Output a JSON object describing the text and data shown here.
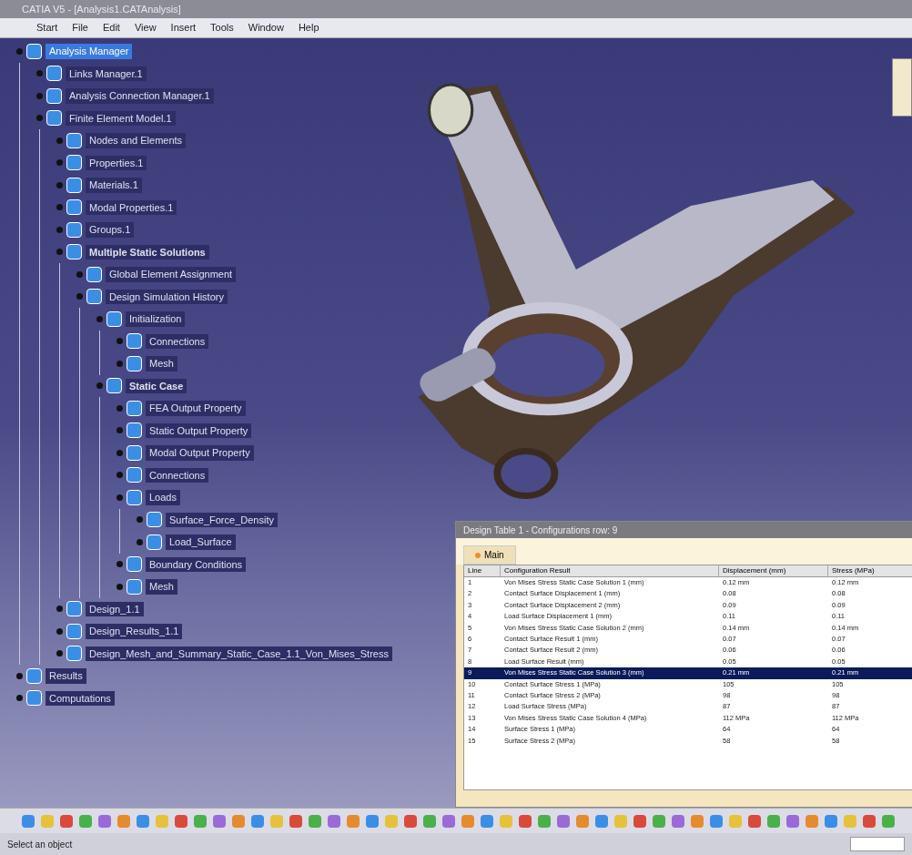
{
  "window": {
    "title": "CATIA V5 - [Analysis1.CATAnalysis]"
  },
  "menu": [
    "Start",
    "File",
    "Edit",
    "View",
    "Insert",
    "Tools",
    "Window",
    "Help"
  ],
  "tree": [
    {
      "label": "Analysis Manager",
      "selected": true,
      "bold": false,
      "children": [
        {
          "label": "Links Manager.1",
          "selected": false,
          "bold": false
        },
        {
          "label": "Analysis Connection Manager.1",
          "selected": false,
          "bold": false
        },
        {
          "label": "Finite Element Model.1",
          "selected": false,
          "bold": false,
          "children": [
            {
              "label": "Nodes and Elements",
              "selected": false,
              "bold": false
            },
            {
              "label": "Properties.1",
              "selected": false,
              "bold": false
            },
            {
              "label": "Materials.1",
              "selected": false,
              "bold": false
            },
            {
              "label": "Modal Properties.1",
              "selected": false,
              "bold": false
            },
            {
              "label": "Groups.1",
              "selected": false,
              "bold": false
            },
            {
              "label": "Multiple Static Solutions",
              "selected": false,
              "bold": true,
              "children": [
                {
                  "label": "Global Element Assignment",
                  "selected": false,
                  "bold": false
                },
                {
                  "label": "Design Simulation History",
                  "selected": false,
                  "bold": false,
                  "children": [
                    {
                      "label": "Initialization",
                      "selected": false,
                      "bold": false,
                      "children": [
                        {
                          "label": "Connections",
                          "selected": false,
                          "bold": false
                        },
                        {
                          "label": "Mesh",
                          "selected": false,
                          "bold": false
                        }
                      ]
                    },
                    {
                      "label": "Static Case",
                      "selected": false,
                      "bold": true,
                      "children": [
                        {
                          "label": "FEA Output Property",
                          "selected": false,
                          "bold": false
                        },
                        {
                          "label": "Static Output Property",
                          "selected": false,
                          "bold": false
                        },
                        {
                          "label": "Modal Output Property",
                          "selected": false,
                          "bold": false
                        },
                        {
                          "label": "Connections",
                          "selected": false,
                          "bold": false
                        },
                        {
                          "label": "Loads",
                          "selected": false,
                          "bold": false,
                          "children": [
                            {
                              "label": "Surface_Force_Density",
                              "selected": false,
                              "bold": false
                            },
                            {
                              "label": "Load_Surface",
                              "selected": false,
                              "bold": false
                            }
                          ]
                        },
                        {
                          "label": "Boundary Conditions",
                          "selected": false,
                          "bold": false
                        },
                        {
                          "label": "Mesh",
                          "selected": false,
                          "bold": false
                        }
                      ]
                    }
                  ]
                }
              ]
            },
            {
              "label": "Design_1.1",
              "selected": false,
              "bold": false
            },
            {
              "label": "Design_Results_1.1",
              "selected": false,
              "bold": false
            },
            {
              "label": "Design_Mesh_and_Summary_Static_Case_1.1_Von_Mises_Stress",
              "selected": false,
              "bold": false
            }
          ]
        }
      ]
    },
    {
      "label": "Results",
      "selected": false,
      "bold": false
    },
    {
      "label": "Computations",
      "selected": false,
      "bold": false
    }
  ],
  "table_window": {
    "title": "Design Table 1 - Configurations row: 9",
    "tab": "Main",
    "columns": [
      "Line",
      "Configuration Result",
      "Displacement (mm)",
      "Stress (MPa)"
    ],
    "rows": [
      {
        "cells": [
          "1",
          "Von Mises Stress Static Case Solution 1 (mm)",
          "0.12 mm",
          "0.12 mm"
        ],
        "selected": false
      },
      {
        "cells": [
          "2",
          "Contact Surface Displacement 1 (mm)",
          "0.08",
          "0.08"
        ],
        "selected": false
      },
      {
        "cells": [
          "3",
          "Contact Surface Displacement 2 (mm)",
          "0.09",
          "0.09"
        ],
        "selected": false
      },
      {
        "cells": [
          "4",
          "Load Surface Displacement 1 (mm)",
          "0.11",
          "0.11"
        ],
        "selected": false
      },
      {
        "cells": [
          "5",
          "Von Mises Stress Static Case Solution 2 (mm)",
          "0.14 mm",
          "0.14 mm"
        ],
        "selected": false
      },
      {
        "cells": [
          "6",
          "Contact Surface Result 1 (mm)",
          "0.07",
          "0.07"
        ],
        "selected": false
      },
      {
        "cells": [
          "7",
          "Contact Surface Result 2 (mm)",
          "0.06",
          "0.06"
        ],
        "selected": false
      },
      {
        "cells": [
          "8",
          "Load Surface Result (mm)",
          "0.05",
          "0.05"
        ],
        "selected": false
      },
      {
        "cells": [
          "9",
          "Von Mises Stress Static Case Solution 3 (mm)",
          "0.21 mm",
          "0.21 mm"
        ],
        "selected": true
      },
      {
        "cells": [
          "10",
          "Contact Surface Stress 1 (MPa)",
          "105",
          "105"
        ],
        "selected": false
      },
      {
        "cells": [
          "11",
          "Contact Surface Stress 2 (MPa)",
          "98",
          "98"
        ],
        "selected": false
      },
      {
        "cells": [
          "12",
          "Load Surface Stress (MPa)",
          "87",
          "87"
        ],
        "selected": false
      },
      {
        "cells": [
          "13",
          "Von Mises Stress Static Case Solution 4 (MPa)",
          "112 MPa",
          "112 MPa"
        ],
        "selected": false
      },
      {
        "cells": [
          "14",
          "Surface Stress 1 (MPa)",
          "64",
          "64"
        ],
        "selected": false
      },
      {
        "cells": [
          "15",
          "Surface Stress 2 (MPa)",
          "58",
          "58"
        ],
        "selected": false
      }
    ]
  },
  "status_bar": {
    "message": "Select an object"
  }
}
